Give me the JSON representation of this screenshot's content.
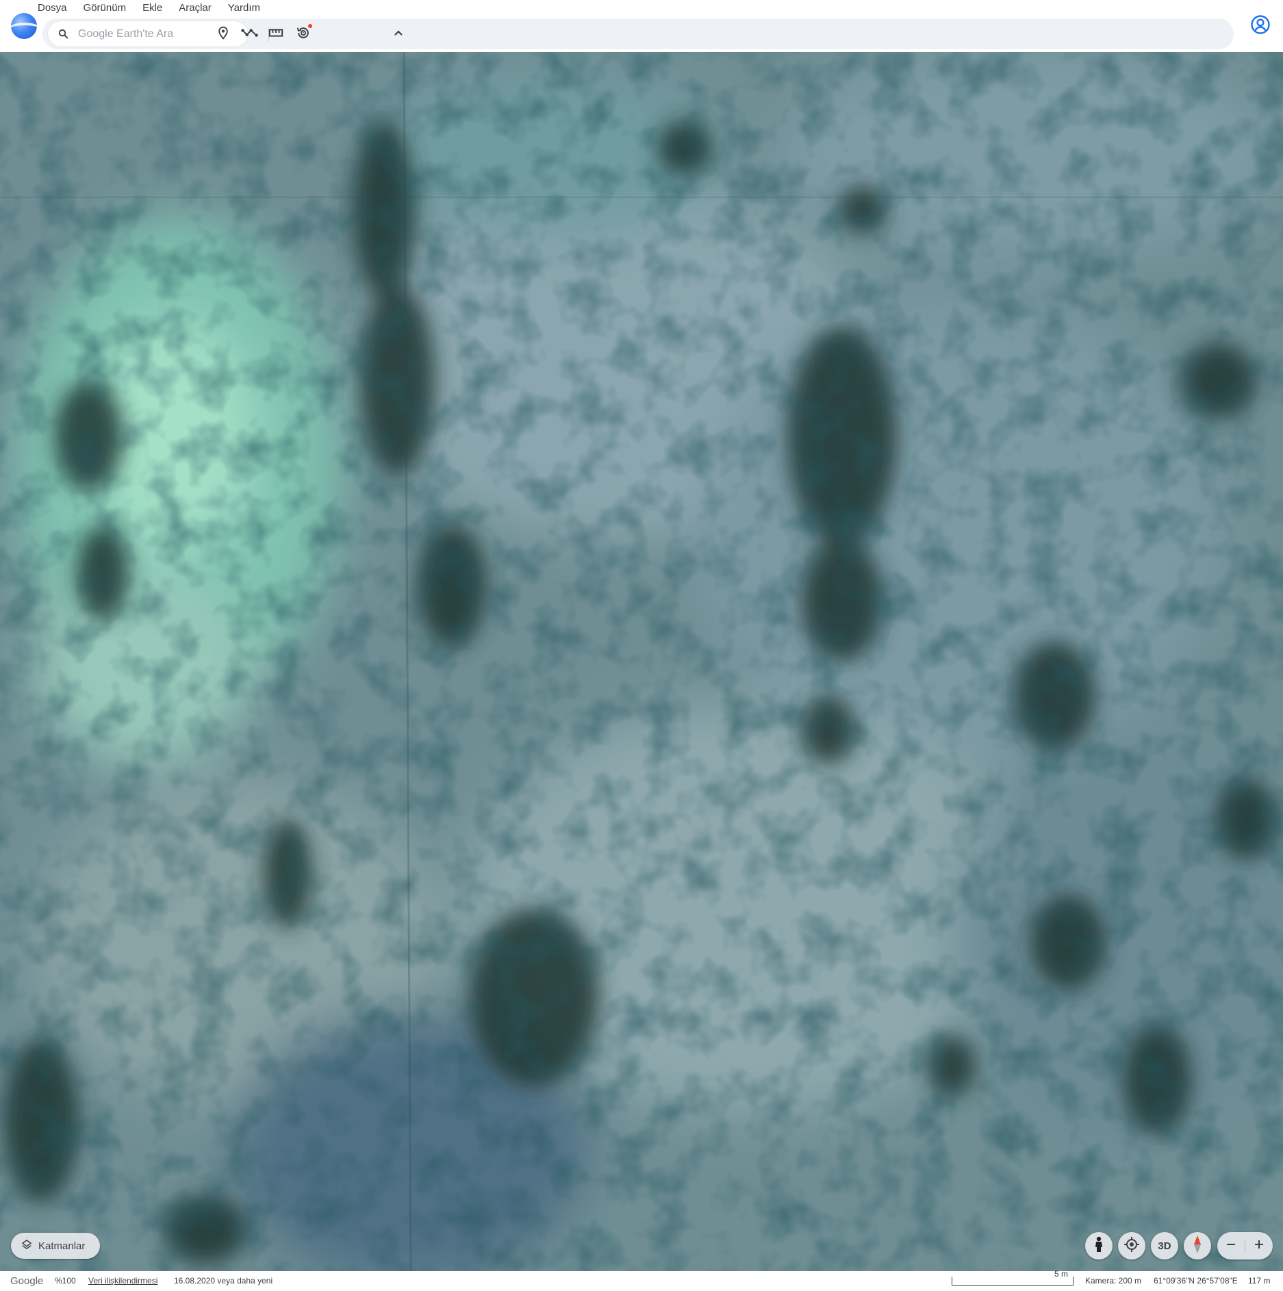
{
  "app": {
    "menu": [
      "Dosya",
      "Görünüm",
      "Ekle",
      "Araçlar",
      "Yardım"
    ],
    "search": {
      "placeholder": "Google Earth'te Ara"
    },
    "toolbar_icons": [
      "placemark-icon",
      "path-icon",
      "ruler-icon",
      "historical-imagery-icon",
      "collapse-chevron-icon"
    ],
    "accent_color": "#1a73e8"
  },
  "map": {
    "imagery": "blurred aerial view of rocky blue-green terrain",
    "layers_label": "Katmanlar",
    "controls": {
      "pegman": "pegman-icon",
      "my_location": "my-location-icon",
      "view_mode": "3D",
      "compass": "compass-icon",
      "zoom_out": "minus-icon",
      "zoom_in": "plus-icon"
    }
  },
  "status": {
    "logo": "Google",
    "zoom": "%100",
    "data_attribution": "Veri ilişkilendirmesi",
    "imagery_date": "16.08.2020 veya daha yeni",
    "scale": "5 m",
    "camera": "Kamera: 200 m",
    "coordinates": "61°09'36\"N 26°57'08\"E",
    "elevation": "117 m"
  }
}
